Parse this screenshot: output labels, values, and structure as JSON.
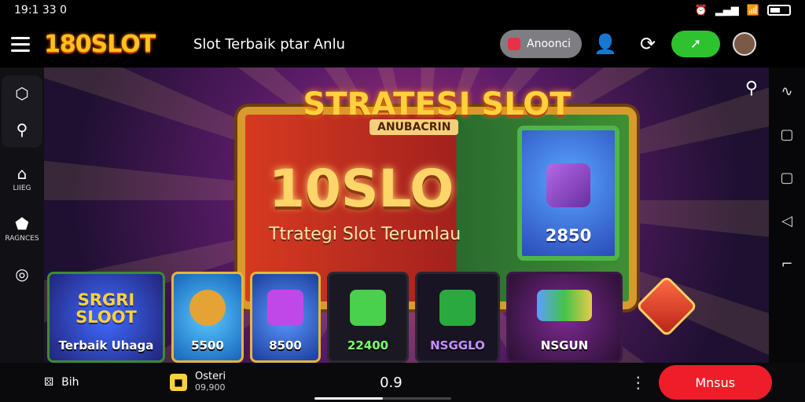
{
  "status": {
    "time": "19:1 33 0"
  },
  "header": {
    "logo": "180SLOT",
    "subtitle": "Slot Terbaik  ptar Anlu",
    "announce_label": "Anoonci",
    "green_button_label": "➚",
    "avatar": "avatar"
  },
  "sidebar": {
    "items": [
      {
        "icon": "shield-icon",
        "label": ""
      },
      {
        "icon": "search-icon",
        "label": ""
      },
      {
        "icon": "home-icon",
        "label": "LIIEG"
      },
      {
        "icon": "house-icon",
        "label": "RAGNCES"
      },
      {
        "icon": "compass-icon",
        "label": ""
      }
    ]
  },
  "banner": {
    "headline": "STRATESI SLOT",
    "headline_sub": "ANUBACRIN",
    "big_word": "10SLO",
    "subtitle": "Ttrategi Slot Terumlau",
    "mini_card_value": "2850"
  },
  "tiles": [
    {
      "title": "SRGRI SLOOT",
      "label": "Terbaik Uhaga",
      "color": "#2b52c9"
    },
    {
      "title": "",
      "label": "5500",
      "color": "#e2a24a"
    },
    {
      "title": "",
      "label": "8500",
      "color": "#8d3fd3"
    },
    {
      "title": "",
      "label": "22400",
      "color": "#2c2b33"
    },
    {
      "title": "",
      "label": "NSGGLO",
      "color": "#1e1830"
    },
    {
      "title": "",
      "label": "NSGUN",
      "color": "#3b1846"
    }
  ],
  "bottombar": {
    "left_label": "Bih",
    "game_title": "Osteri",
    "game_sub": "09,900",
    "center_value": "0.9",
    "primary_label": "Mnsus",
    "progress": 0.5
  }
}
